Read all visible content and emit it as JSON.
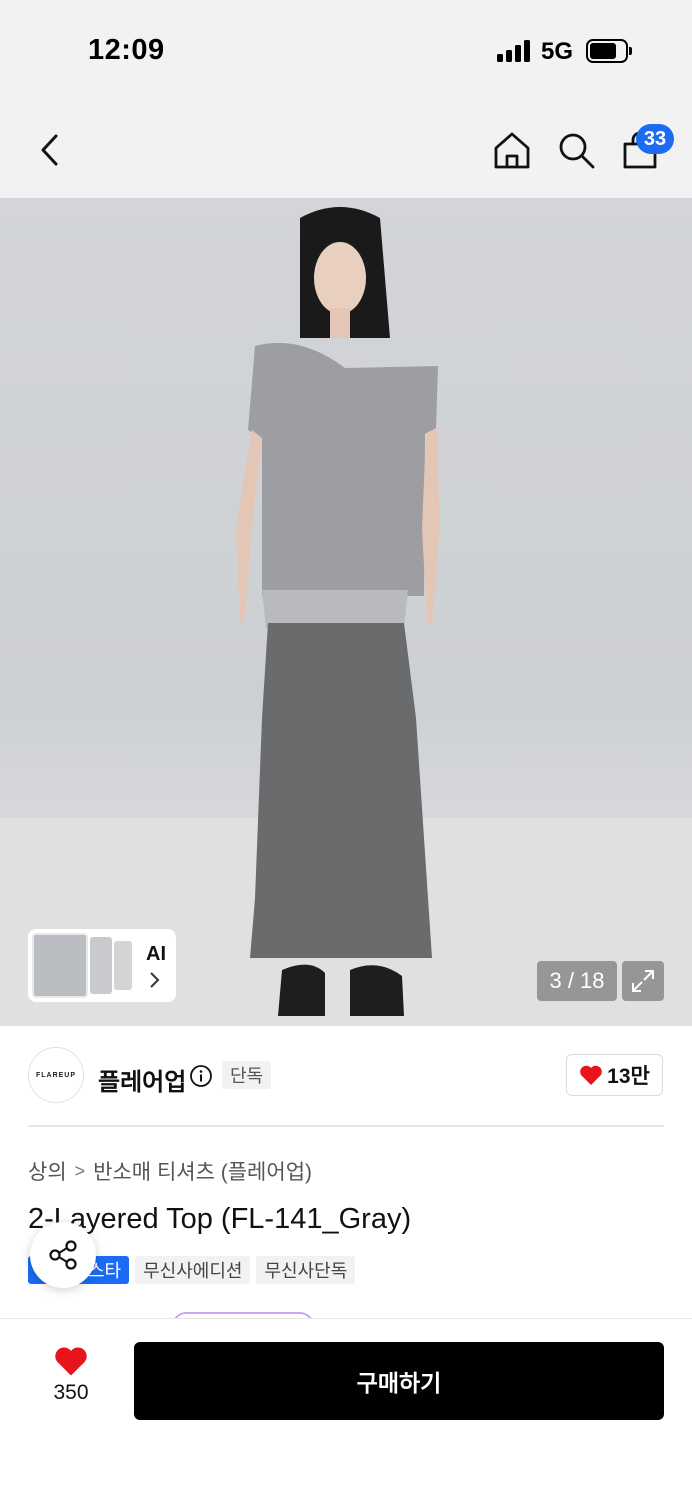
{
  "status_bar": {
    "time": "12:09",
    "network": "5G",
    "battery_level": 0.7
  },
  "header": {
    "back_icon": "chevron-left-icon",
    "home_icon": "home-icon",
    "search_icon": "search-icon",
    "cart_icon": "shopping-bag-icon",
    "cart_count": "33",
    "badge_color": "#1b6cf2"
  },
  "gallery": {
    "ai_label": "AI",
    "current_page": "3 / 18",
    "expand_icon": "expand-icon"
  },
  "brand": {
    "logo_text": "FLAREUP",
    "name": "플레어업",
    "exclusive_tag": "단독",
    "like_count": "13만"
  },
  "product": {
    "breadcrumb": [
      "상의",
      "반소매 티셔츠 (플레어업)"
    ],
    "title": "2-Layered Top (FL-141_Gray)",
    "badges": [
      "스타",
      "무신사에디션",
      "무신사단독"
    ]
  },
  "bottom_bar": {
    "wish_count": "350",
    "buy_label": "구매하기"
  }
}
